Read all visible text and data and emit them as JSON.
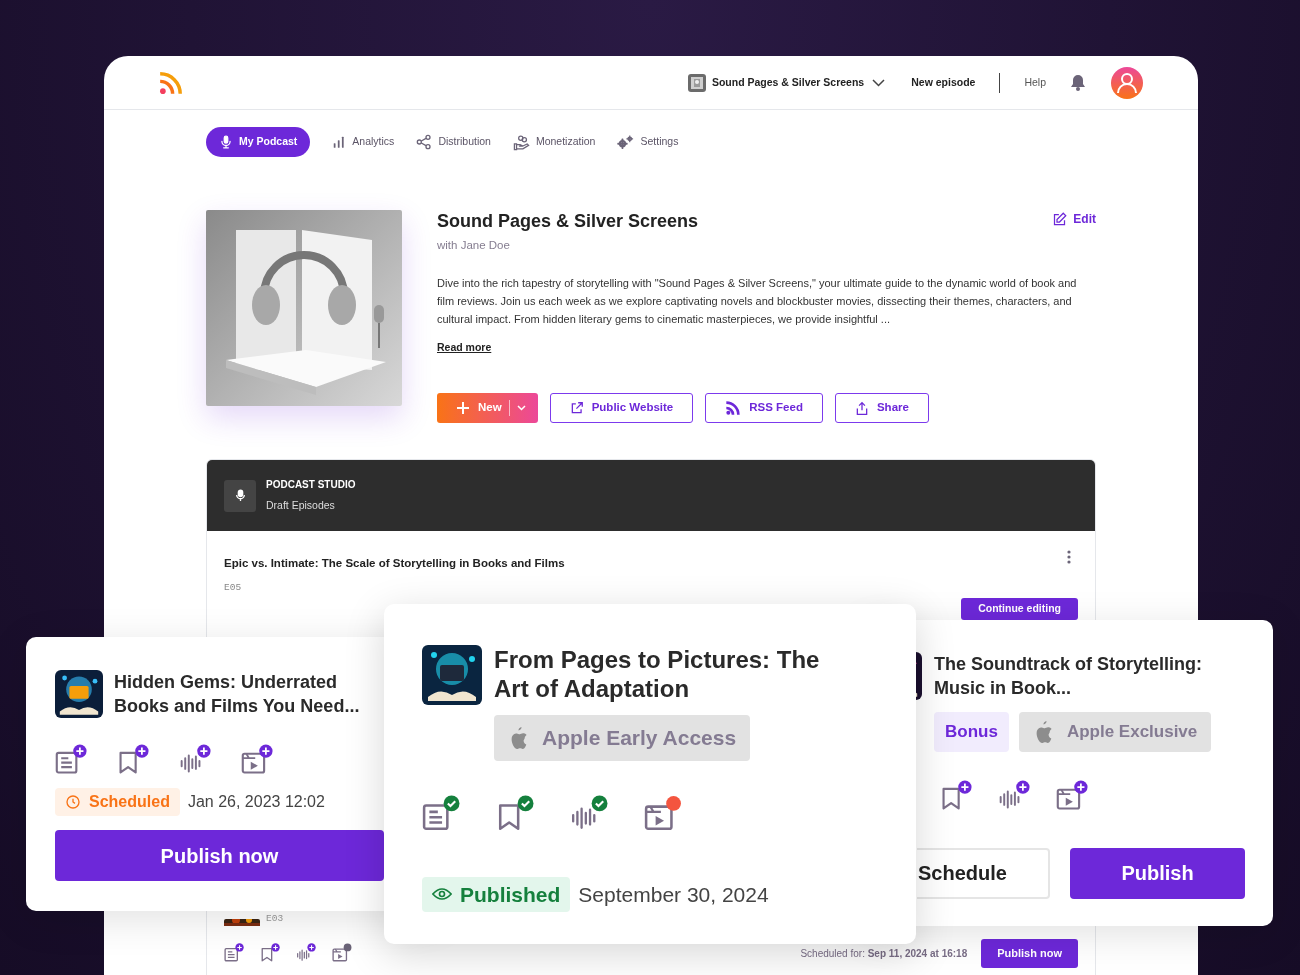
{
  "header": {
    "show_selector": "Sound Pages & Silver Screens",
    "new_episode": "New episode",
    "help": "Help"
  },
  "nav_tabs": [
    {
      "label": "My Podcast",
      "selected": true
    },
    {
      "label": "Analytics",
      "selected": false
    },
    {
      "label": "Distribution",
      "selected": false
    },
    {
      "label": "Monetization",
      "selected": false
    },
    {
      "label": "Settings",
      "selected": false
    }
  ],
  "podcast": {
    "title": "Sound Pages & Silver Screens",
    "host": "with Jane Doe",
    "edit": "Edit",
    "description": "Dive into the rich tapestry of storytelling with \"Sound Pages & Silver Screens,\" your ultimate guide to the dynamic world of book and film reviews. Join us each week as we explore captivating novels and blockbuster movies, dissecting their themes, characters, and cultural impact. From hidden literary gems to cinematic masterpieces, we provide insightful ...",
    "read_more": "Read more",
    "actions": [
      {
        "label": "New",
        "kind": "split"
      },
      {
        "label": "Public Website",
        "kind": "outline"
      },
      {
        "label": "RSS Feed",
        "kind": "outline"
      },
      {
        "label": "Share",
        "kind": "outline"
      }
    ]
  },
  "studio": {
    "title": "PODCAST STUDIO",
    "subtitle": "Draft Episodes",
    "episode": {
      "title": "Epic vs. Intimate: The Scale of Storytelling in Books and Films",
      "code": "E05",
      "button": "Continue editing"
    },
    "episode_2": {
      "code": "E03",
      "scheduled": "Scheduled for: **Sep 11, 2024 at 16:18**",
      "button": "Publish now",
      "assets": [
        {
          "kind": "document",
          "complete": false
        },
        {
          "kind": "bookmark",
          "complete": false
        },
        {
          "kind": "waveform",
          "complete": false
        },
        {
          "kind": "video",
          "complete": false,
          "color": "#6b6478"
        }
      ]
    }
  },
  "cards": [
    {
      "title": "Hidden Gems: Underrated Books and Films You Need...",
      "assets": [
        {
          "kind": "document",
          "complete": false
        },
        {
          "kind": "bookmark",
          "complete": false
        },
        {
          "kind": "waveform",
          "complete": false
        },
        {
          "kind": "video",
          "complete": false
        }
      ],
      "status": {
        "label": "Scheduled",
        "kind": "scheduled"
      },
      "date": "Jan 26, 2023 12:02",
      "buttons": [
        {
          "label": "Publish now",
          "kind": "primary"
        }
      ]
    },
    {
      "title": "From Pages to Pictures: The Art of Adaptation",
      "tags": [
        {
          "label": "Apple Early Access",
          "kind": "apple"
        }
      ],
      "assets": [
        {
          "kind": "document",
          "complete": true
        },
        {
          "kind": "bookmark",
          "complete": true
        },
        {
          "kind": "waveform",
          "complete": true
        },
        {
          "kind": "video",
          "complete": false,
          "color": "#f4553f"
        }
      ],
      "status": {
        "label": "Published",
        "kind": "published"
      },
      "date": "September 30, 2024"
    },
    {
      "title": "The Soundtrack of Storytelling: Music in Book...",
      "tags": [
        {
          "label": "Bonus",
          "kind": "bonus"
        },
        {
          "label": "Apple Exclusive",
          "kind": "apple"
        }
      ],
      "assets": [
        {
          "kind": "bookmark",
          "complete": false
        },
        {
          "kind": "waveform",
          "complete": false
        },
        {
          "kind": "video",
          "complete": false
        }
      ],
      "buttons": [
        {
          "label": "Schedule",
          "kind": "outline"
        },
        {
          "label": "Publish",
          "kind": "primary"
        }
      ]
    }
  ]
}
